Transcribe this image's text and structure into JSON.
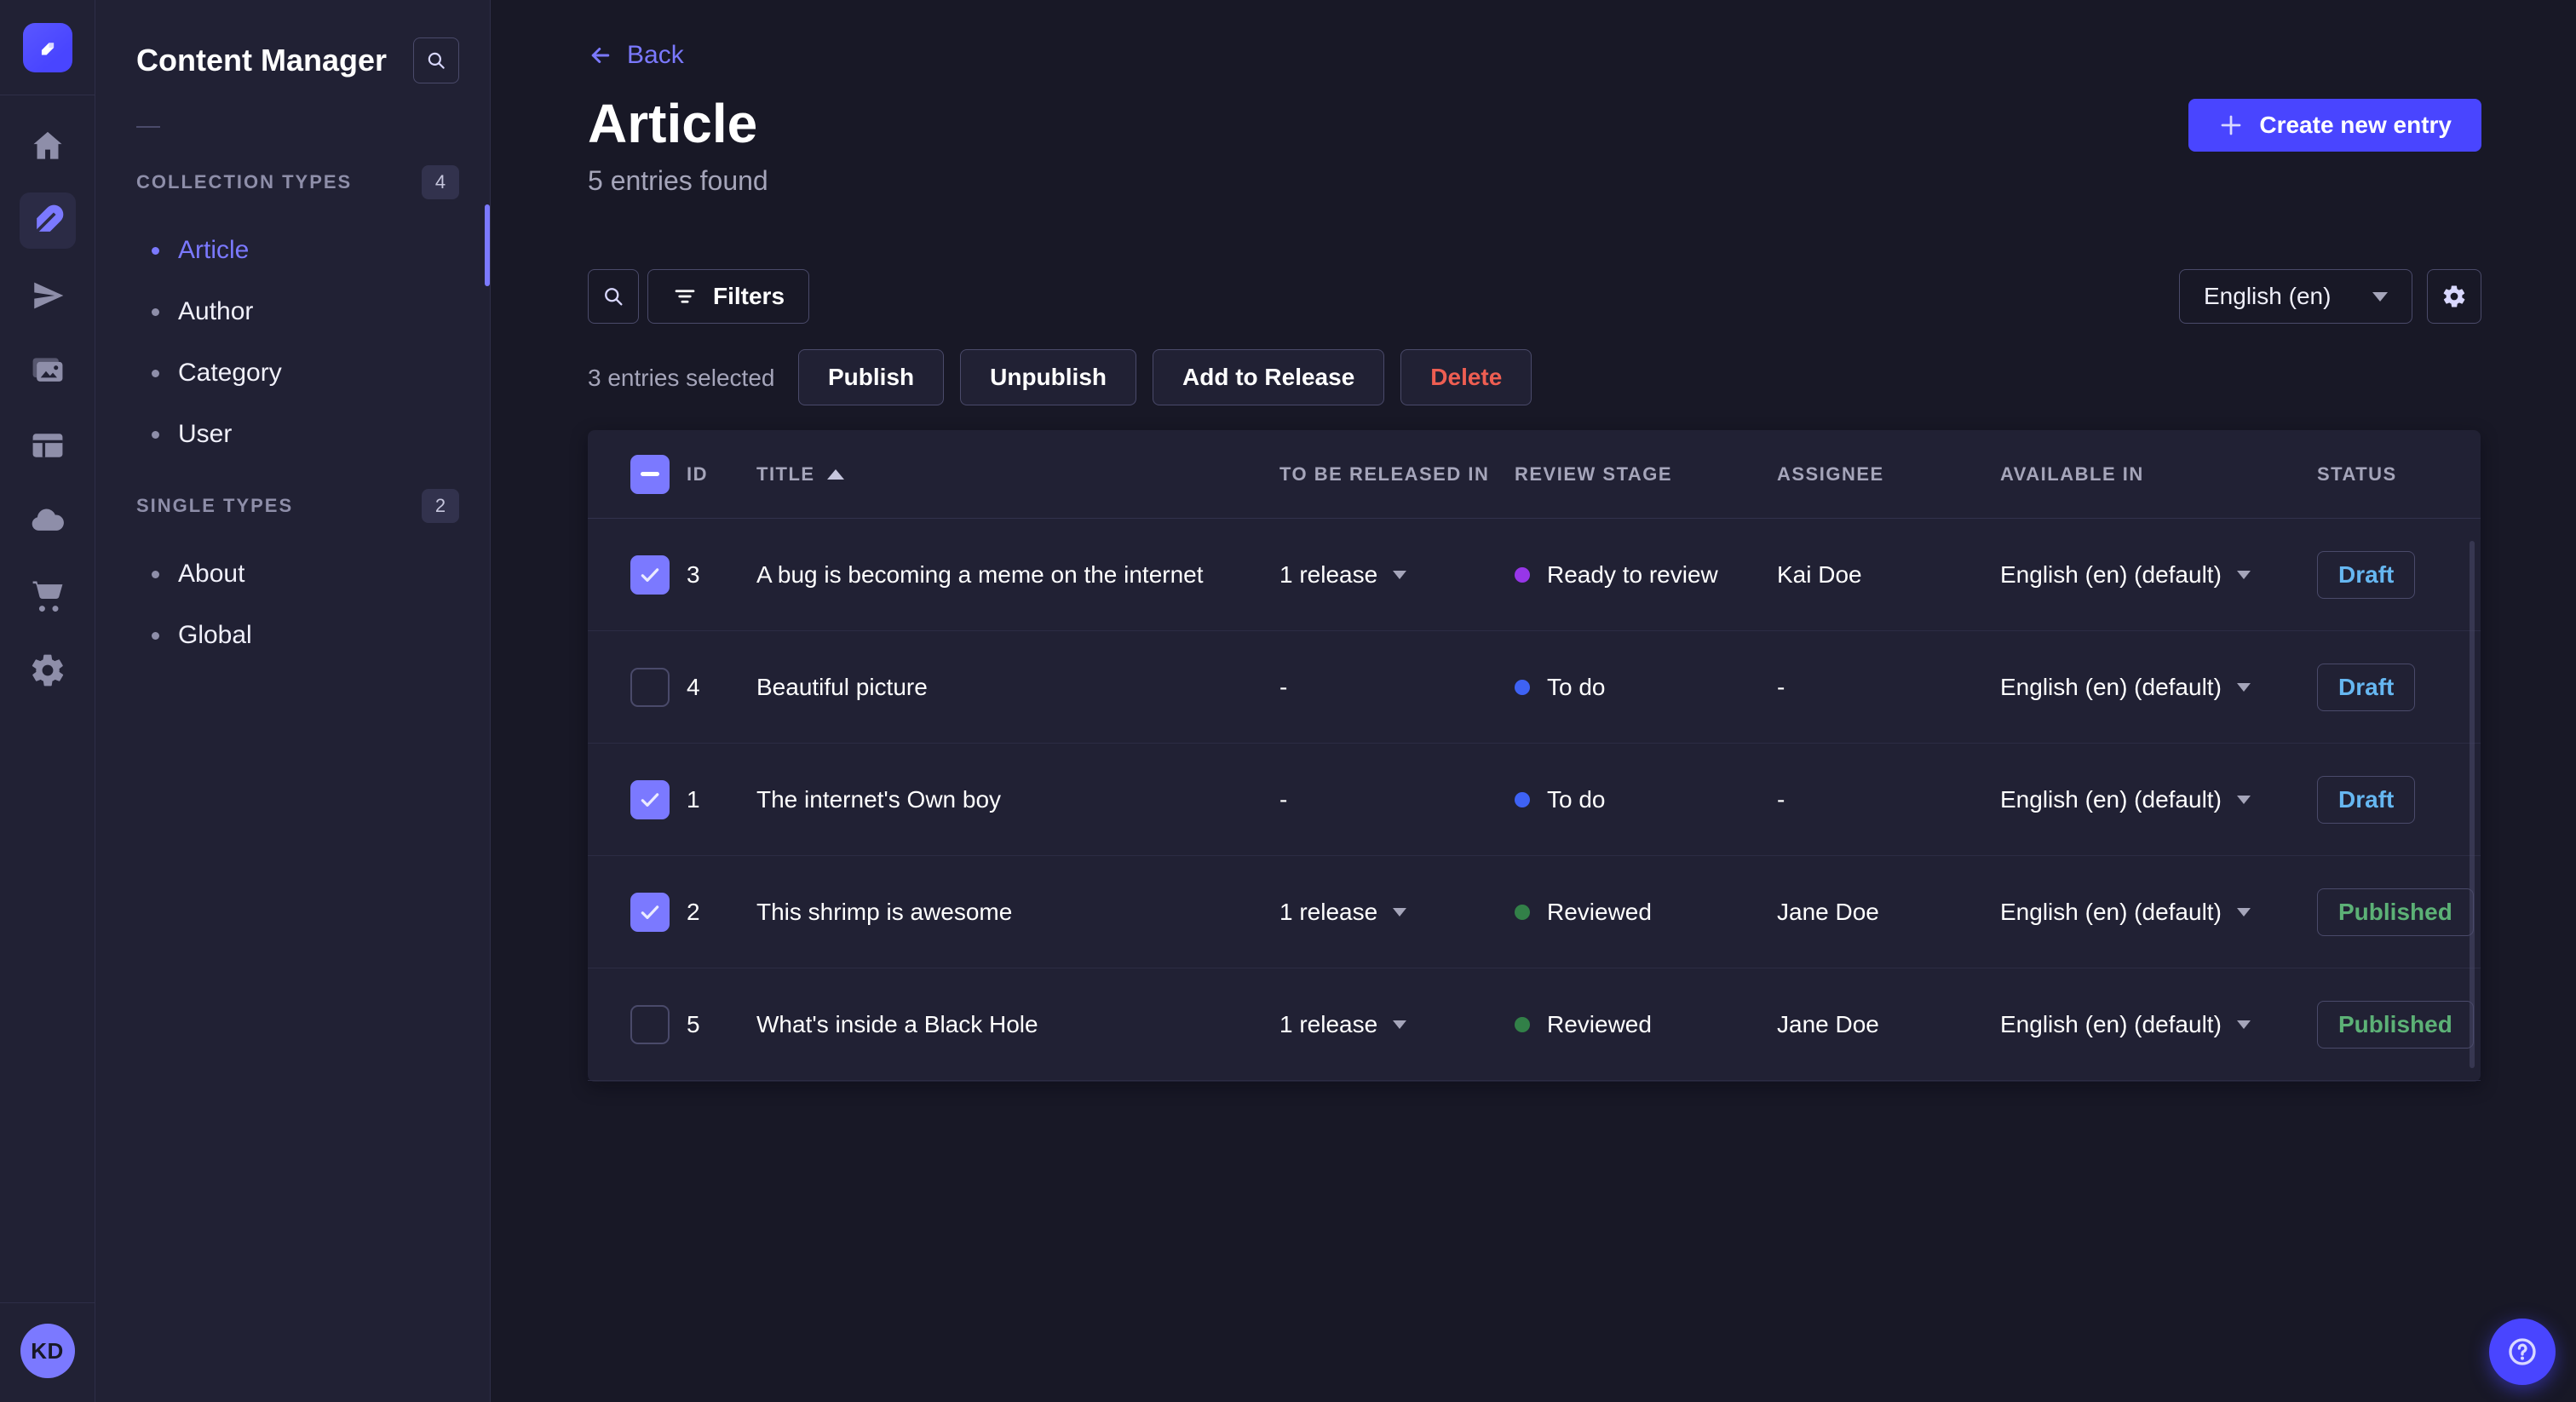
{
  "rail": {
    "icons": [
      "home",
      "content-manager",
      "send",
      "media-library",
      "content-type-builder",
      "cloud",
      "marketplace",
      "settings"
    ],
    "active_icon": "content-manager",
    "avatar_initials": "KD"
  },
  "nav": {
    "title": "Content Manager",
    "sections": [
      {
        "label": "COLLECTION TYPES",
        "badge": "4",
        "items": [
          {
            "label": "Article",
            "active": true
          },
          {
            "label": "Author",
            "active": false
          },
          {
            "label": "Category",
            "active": false
          },
          {
            "label": "User",
            "active": false
          }
        ]
      },
      {
        "label": "SINGLE TYPES",
        "badge": "2",
        "items": [
          {
            "label": "About",
            "active": false
          },
          {
            "label": "Global",
            "active": false
          }
        ]
      }
    ]
  },
  "header": {
    "back_label": "Back",
    "title": "Article",
    "entries_found": "5 entries found",
    "create_button_label": "Create new entry"
  },
  "toolbar": {
    "filters_label": "Filters",
    "locale_value": "English (en)"
  },
  "selection": {
    "summary": "3 entries selected",
    "publish_label": "Publish",
    "unpublish_label": "Unpublish",
    "add_to_release_label": "Add to Release",
    "delete_label": "Delete"
  },
  "table": {
    "headers": {
      "id": "ID",
      "title": "TITLE",
      "to_be_released_in": "TO BE RELEASED IN",
      "review_stage": "REVIEW STAGE",
      "assignee": "ASSIGNEE",
      "available_in": "AVAILABLE IN",
      "status": "STATUS"
    },
    "sort": {
      "column": "TITLE",
      "direction": "ascending"
    },
    "rows": [
      {
        "checked": true,
        "id": "3",
        "title": "A bug is becoming a meme on the internet",
        "to_be_released_in": "1 release",
        "review_stage": "Ready to review",
        "review_stage_color": "#9736e8",
        "assignee": "Kai Doe",
        "available_in": "English (en) (default)",
        "status": "Draft"
      },
      {
        "checked": false,
        "id": "4",
        "title": "Beautiful picture",
        "to_be_released_in": "-",
        "review_stage": "To do",
        "review_stage_color": "#3e62f4",
        "assignee": "-",
        "available_in": "English (en) (default)",
        "status": "Draft"
      },
      {
        "checked": true,
        "id": "1",
        "title": "The internet's Own boy",
        "to_be_released_in": "-",
        "review_stage": "To do",
        "review_stage_color": "#3e62f4",
        "assignee": "-",
        "available_in": "English (en) (default)",
        "status": "Draft"
      },
      {
        "checked": true,
        "id": "2",
        "title": "This shrimp is awesome",
        "to_be_released_in": "1 release",
        "review_stage": "Reviewed",
        "review_stage_color": "#328048",
        "assignee": "Jane Doe",
        "available_in": "English (en) (default)",
        "status": "Published"
      },
      {
        "checked": false,
        "id": "5",
        "title": "What's inside a Black Hole",
        "to_be_released_in": "1 release",
        "review_stage": "Reviewed",
        "review_stage_color": "#328048",
        "assignee": "Jane Doe",
        "available_in": "English (en) (default)",
        "status": "Published"
      }
    ]
  },
  "colors": {
    "primary": "#4945ff",
    "accent_purple": "#7b79ff",
    "draft_text": "#66b7f1",
    "published_text": "#5cb176",
    "danger_text": "#ee5e52",
    "dot_ready_to_review": "#9736e8",
    "dot_to_do": "#3e62f4",
    "dot_reviewed": "#328048"
  }
}
